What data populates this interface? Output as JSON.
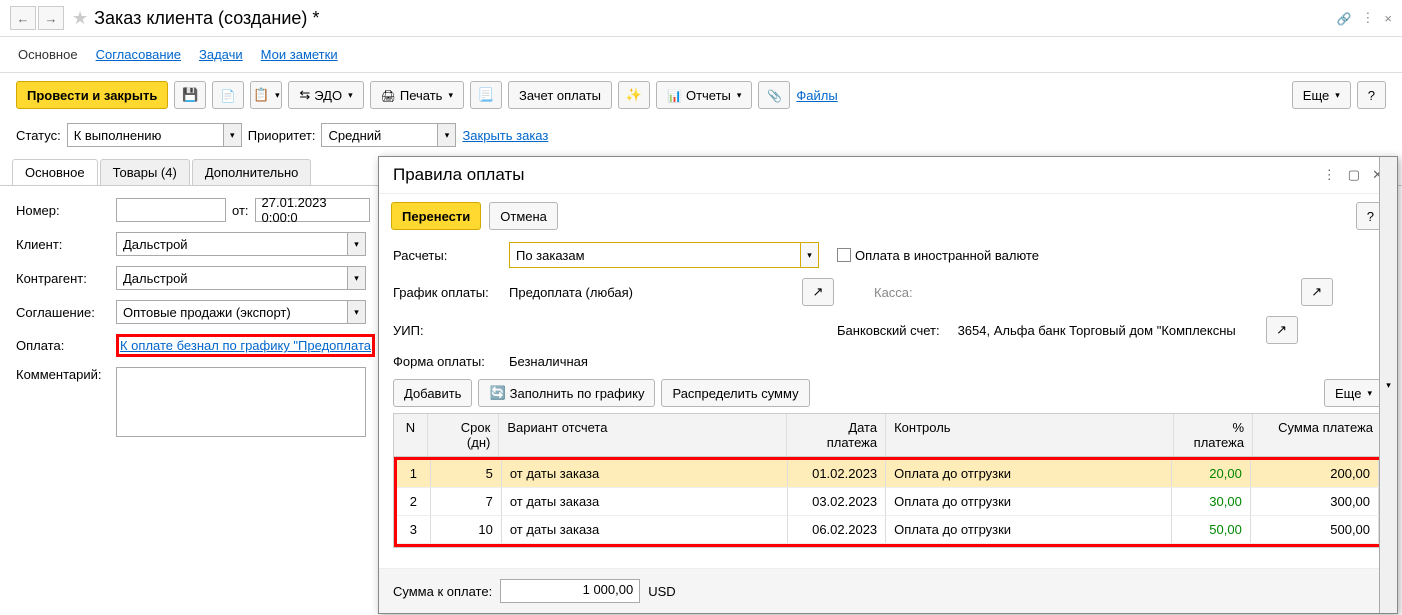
{
  "header": {
    "title": "Заказ клиента (создание) *"
  },
  "nav_tabs": {
    "main": "Основное",
    "approval": "Согласование",
    "tasks": "Задачи",
    "notes": "Мои заметки"
  },
  "toolbar": {
    "post_close": "Провести и закрыть",
    "edo": "ЭДО",
    "print": "Печать",
    "offset": "Зачет оплаты",
    "reports": "Отчеты",
    "files": "Файлы",
    "more": "Еще",
    "help": "?"
  },
  "status_row": {
    "status_lbl": "Статус:",
    "status_val": "К выполнению",
    "priority_lbl": "Приоритет:",
    "priority_val": "Средний",
    "close_link": "Закрыть заказ"
  },
  "inner_tabs": {
    "main": "Основное",
    "goods": "Товары (4)",
    "extra": "Дополнительно"
  },
  "form": {
    "number_lbl": "Номер:",
    "ot": "от:",
    "date": "27.01.2023  0:00:0",
    "client_lbl": "Клиент:",
    "client": "Дальстрой",
    "counterparty_lbl": "Контрагент:",
    "counterparty": "Дальстрой",
    "agreement_lbl": "Соглашение:",
    "agreement": "Оптовые продажи (экспорт)",
    "payment_lbl": "Оплата:",
    "payment_link": "К оплате безнал по графику \"Предоплата",
    "comment_lbl": "Комментарий:"
  },
  "popup": {
    "title": "Правила оплаты",
    "transfer": "Перенести",
    "cancel": "Отмена",
    "help": "?",
    "more": "Еще",
    "calc_lbl": "Расчеты:",
    "calc_val": "По заказам",
    "foreign_cb": "Оплата в иностранной валюте",
    "schedule_lbl": "График оплаты:",
    "schedule_val": "Предоплата (любая)",
    "kassa_lbl": "Касса:",
    "uip_lbl": "УИП:",
    "bank_lbl": "Банковский счет:",
    "bank_val": "3654, Альфа банк Торговый дом \"Комплексны",
    "payform_lbl": "Форма оплаты:",
    "payform_val": "Безналичная",
    "add": "Добавить",
    "fill": "Заполнить по графику",
    "distribute": "Распределить сумму",
    "columns": {
      "n": "N",
      "srok": "Срок (дн)",
      "variant": "Вариант отсчета",
      "date": "Дата платежа",
      "control": "Контроль",
      "pct": "% платежа",
      "sum": "Сумма платежа"
    },
    "rows": [
      {
        "n": "1",
        "srok": "5",
        "variant": "от даты заказа",
        "date": "01.02.2023",
        "control": "Оплата до отгрузки",
        "pct": "20,00",
        "sum": "200,00"
      },
      {
        "n": "2",
        "srok": "7",
        "variant": "от даты заказа",
        "date": "03.02.2023",
        "control": "Оплата до отгрузки",
        "pct": "30,00",
        "sum": "300,00"
      },
      {
        "n": "3",
        "srok": "10",
        "variant": "от даты заказа",
        "date": "06.02.2023",
        "control": "Оплата до отгрузки",
        "pct": "50,00",
        "sum": "500,00"
      }
    ],
    "footer_lbl": "Сумма к оплате:",
    "footer_sum": "1 000,00",
    "footer_cur": "USD"
  }
}
